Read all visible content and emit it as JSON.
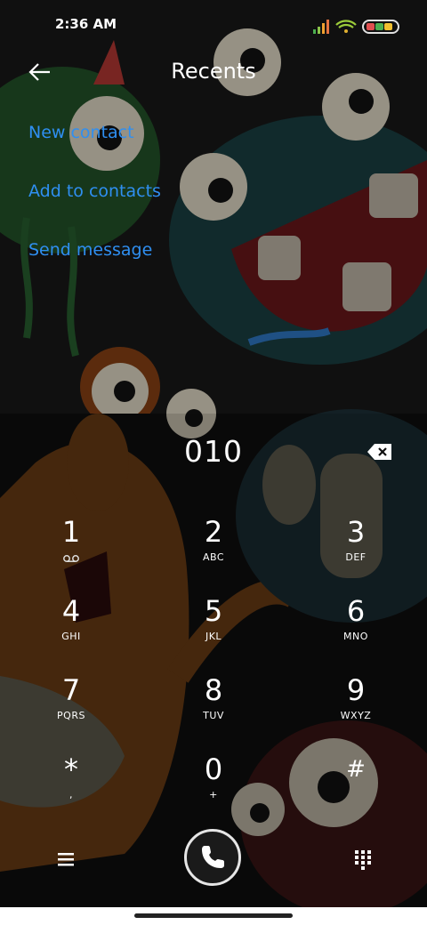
{
  "status_bar": {
    "time": "2:36 AM"
  },
  "header": {
    "title": "Recents"
  },
  "menu": [
    {
      "label": "New contact"
    },
    {
      "label": "Add to contacts"
    },
    {
      "label": "Send message"
    }
  ],
  "dialer": {
    "number": "010",
    "keys": [
      {
        "digit": "1",
        "letters": ""
      },
      {
        "digit": "2",
        "letters": "ABC"
      },
      {
        "digit": "3",
        "letters": "DEF"
      },
      {
        "digit": "4",
        "letters": "GHI"
      },
      {
        "digit": "5",
        "letters": "JKL"
      },
      {
        "digit": "6",
        "letters": "MNO"
      },
      {
        "digit": "7",
        "letters": "PQRS"
      },
      {
        "digit": "8",
        "letters": "TUV"
      },
      {
        "digit": "9",
        "letters": "WXYZ"
      },
      {
        "digit": "*",
        "letters": ","
      },
      {
        "digit": "0",
        "letters": "+"
      },
      {
        "digit": "#",
        "letters": ""
      }
    ]
  },
  "colors": {
    "link": "#2f8ff1",
    "background": "#111111"
  }
}
